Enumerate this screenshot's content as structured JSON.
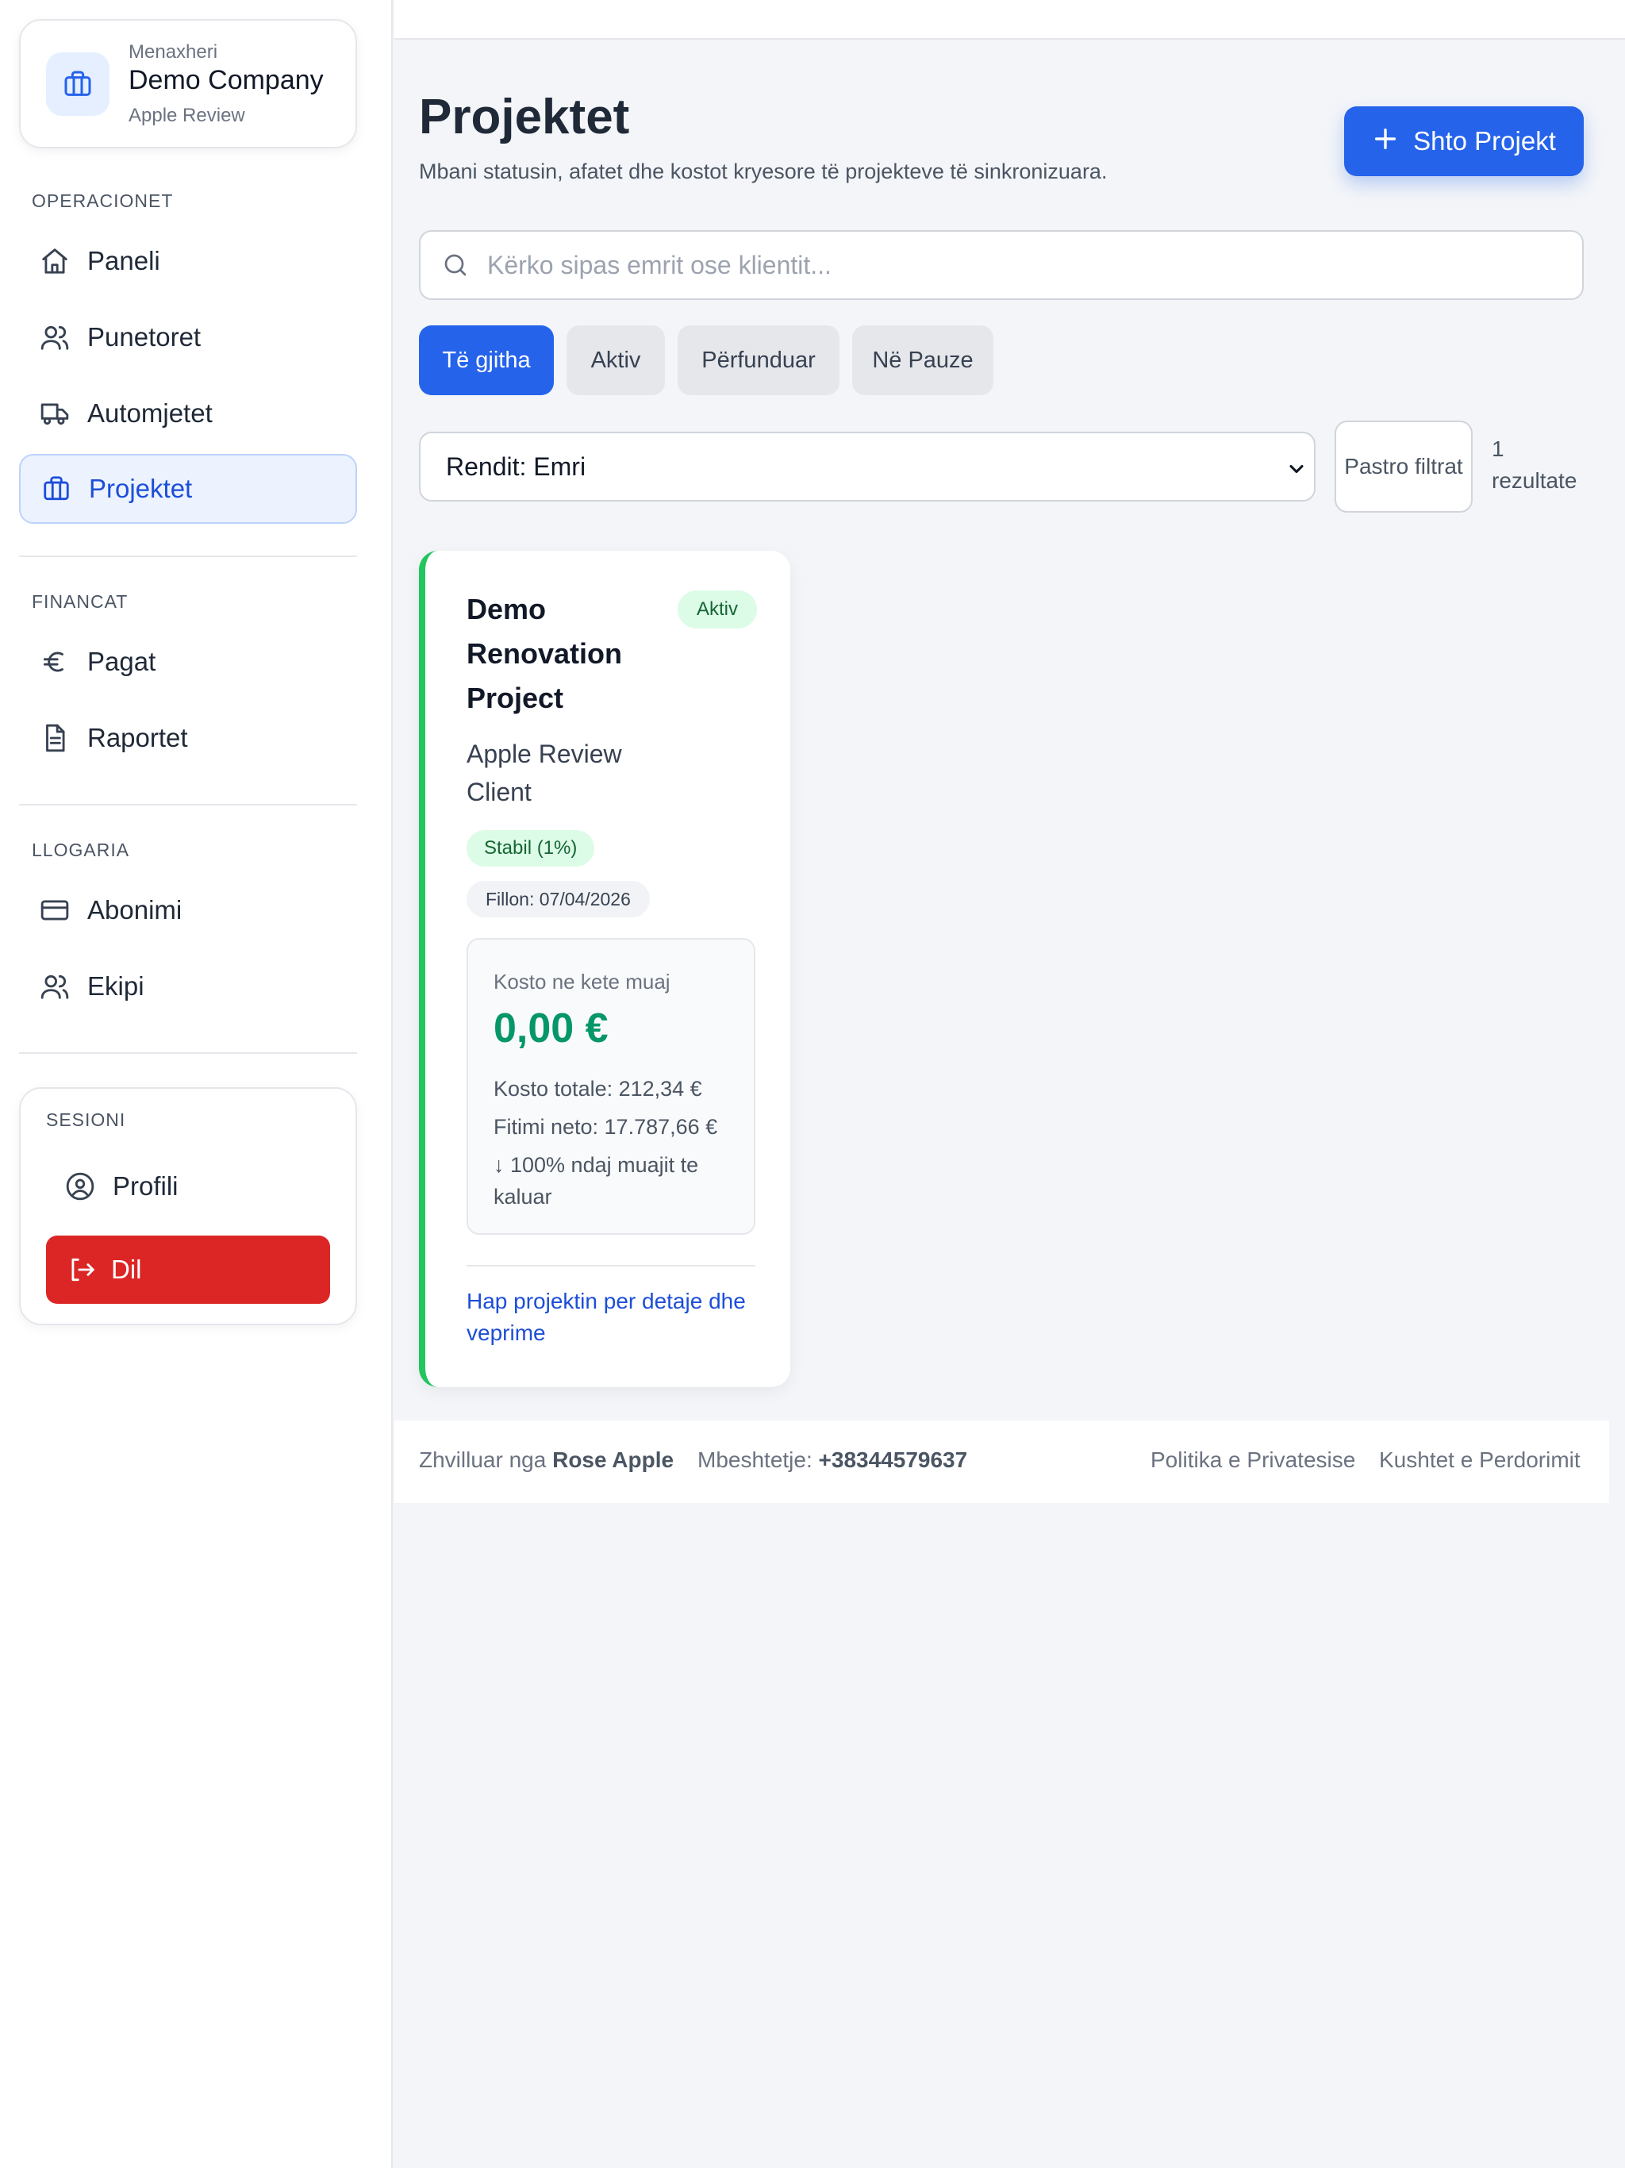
{
  "company": {
    "role": "Menaxheri",
    "name": "Demo Company",
    "subtitle": "Apple Review"
  },
  "sidebar": {
    "sections": [
      {
        "label": "OPERACIONET"
      },
      {
        "label": "FINANCAT"
      },
      {
        "label": "LLOGARIA"
      }
    ],
    "items": [
      {
        "label": "Paneli",
        "icon": "home-icon"
      },
      {
        "label": "Punetoret",
        "icon": "users-icon"
      },
      {
        "label": "Automjetet",
        "icon": "truck-icon"
      },
      {
        "label": "Projektet",
        "icon": "briefcase-icon",
        "active": true
      },
      {
        "label": "Pagat",
        "icon": "euro-icon"
      },
      {
        "label": "Raportet",
        "icon": "document-icon"
      },
      {
        "label": "Abonimi",
        "icon": "credit-card-icon"
      },
      {
        "label": "Ekipi",
        "icon": "team-icon"
      }
    ],
    "session": {
      "label": "SESIONI",
      "profile": "Profili",
      "logout": "Dil"
    }
  },
  "header": {
    "title": "Projektet",
    "subtitle": "Mbani statusin, afatet dhe kostot kryesore të projekteve të sinkronizuara.",
    "add_button": "Shto Projekt"
  },
  "search": {
    "placeholder": "Kërko sipas emrit ose klientit...",
    "value": ""
  },
  "filters": [
    {
      "label": "Të gjitha",
      "active": true
    },
    {
      "label": "Aktiv"
    },
    {
      "label": "Përfunduar"
    },
    {
      "label": "Në Pauze"
    }
  ],
  "sort": {
    "selected": "Rendit: Emri"
  },
  "clear_filters": "Pastro filtrat",
  "results_count": "1 rezultate",
  "projects": [
    {
      "title": "Demo Renovation Project",
      "status": "Aktiv",
      "client": "Apple Review Client",
      "health_badge": "Stabil (1%)",
      "start_badge": "Fillon: 07/04/2026",
      "cost_label": "Kosto ne kete muaj",
      "cost_value": "0,00 €",
      "total_cost": "Kosto totale: 212,34 €",
      "net_profit": "Fitimi neto: 17.787,66 €",
      "trend": "↓ 100% ndaj muajit te kaluar",
      "link": "Hap projektin per detaje dhe veprime"
    }
  ],
  "footer": {
    "developed_by_label": "Zhvilluar nga",
    "developed_by": "Rose Apple",
    "support_label": "Mbeshtetje:",
    "support_phone": "+38344579637",
    "privacy": "Politika e Privatesise",
    "terms": "Kushtet e Perdorimit"
  },
  "colors": {
    "primary": "#2563eb",
    "danger": "#dc2626",
    "success": "#059669",
    "success_bg": "#dcfce7",
    "active_nav_bg": "#ecf3ff"
  }
}
